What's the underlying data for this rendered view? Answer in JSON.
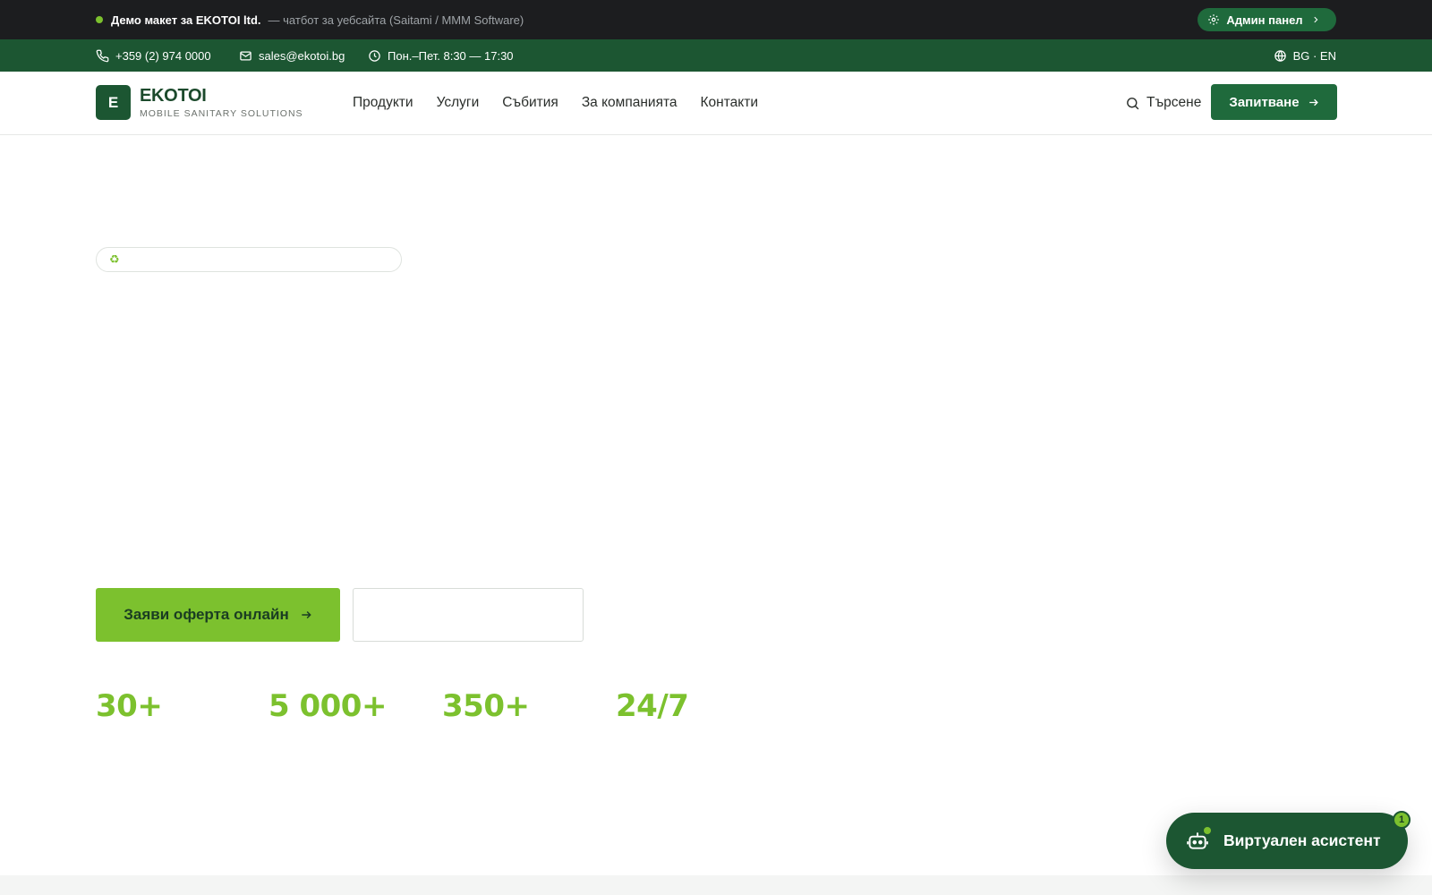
{
  "demo_bar": {
    "title": "Демо макет за EKOTOI ltd.",
    "subtitle": "— чатбот за уебсайта (Saitami / MMM Software)",
    "admin_label": "Админ панел"
  },
  "contact": {
    "phone": "+359 (2) 974 0000",
    "email": "sales@ekotoi.bg",
    "hours": "Пон.–Пет. 8:30 — 17:30",
    "lang": "BG · EN"
  },
  "header": {
    "logo_letter": "E",
    "logo_name": "EKOTOI",
    "logo_tagline": "MOBILE SANITARY SOLUTIONS",
    "nav": [
      "Продукти",
      "Услуги",
      "Събития",
      "За компанията",
      "Контакти"
    ],
    "search_label": "Търсене",
    "inquiry_label": "Запитване"
  },
  "hero": {
    "pill_icon": "♻",
    "cta_primary": "Заяви оферта онлайн",
    "cta_secondary": ""
  },
  "stats": [
    "30+",
    "5 000+",
    "350+",
    "24/7"
  ],
  "chat": {
    "label": "Виртуален асистент",
    "badge": "1"
  },
  "colors": {
    "dark_green": "#1c5632",
    "accent_green": "#7cc12e",
    "top_bar": "#1c1d1f"
  }
}
